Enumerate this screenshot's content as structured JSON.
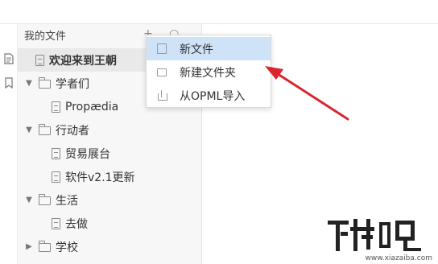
{
  "sidebar": {
    "header": "我的文件",
    "tools": "+ ○ ↓",
    "items": [
      {
        "label": "欢迎来到王朝",
        "type": "doc",
        "selected": true
      },
      {
        "label": "学者们",
        "type": "folder"
      },
      {
        "label": "Propædia",
        "type": "doc"
      },
      {
        "label": "行动者",
        "type": "folder"
      },
      {
        "label": "贸易展台",
        "type": "doc"
      },
      {
        "label": "软件v2.1更新",
        "type": "doc"
      },
      {
        "label": "生活",
        "type": "folder"
      },
      {
        "label": "去做",
        "type": "doc"
      },
      {
        "label": "学校",
        "type": "folder"
      }
    ]
  },
  "menu": {
    "items": [
      {
        "label": "新文件",
        "icon": "new-file-icon",
        "highlighted": true
      },
      {
        "label": "新建文件夹",
        "icon": "new-folder-icon"
      },
      {
        "label": "从OPML导入",
        "icon": "import-icon"
      }
    ]
  },
  "watermark": {
    "text": "www.xiazaiba.com"
  },
  "colors": {
    "highlight": "#cfe3f8",
    "arrow": "#d9262c",
    "sidebar_bg": "#f7f7f7"
  }
}
